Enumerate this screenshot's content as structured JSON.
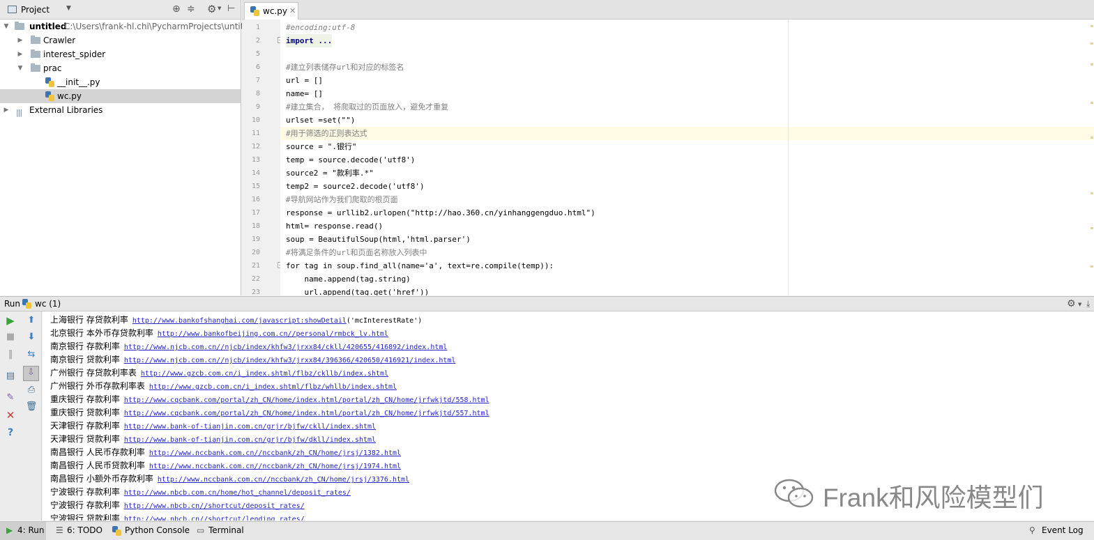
{
  "project_panel": {
    "title": "Project",
    "tree": [
      {
        "label": "untitled",
        "path": "C:\\Users\\frank-hl.chi\\PycharmProjects\\untitled"
      },
      {
        "label": "Crawler"
      },
      {
        "label": "interest_spider"
      },
      {
        "label": "prac"
      },
      {
        "label": "__init__.py"
      },
      {
        "label": "wc.py"
      },
      {
        "label": "External Libraries"
      }
    ]
  },
  "editor": {
    "tab": "wc.py",
    "lines": [
      {
        "n": "1",
        "t": "#encoding:utf-8"
      },
      {
        "n": "2",
        "t": "import ..."
      },
      {
        "n": "5",
        "t": ""
      },
      {
        "n": "6",
        "t": "#建立列表储存url和对应的标签名"
      },
      {
        "n": "7",
        "t": "url = []"
      },
      {
        "n": "8",
        "t": "name= []"
      },
      {
        "n": "9",
        "t": "#建立集合， 将爬取过的页面放入，避免才重复"
      },
      {
        "n": "10",
        "t": "urlset =set(\"\")"
      },
      {
        "n": "11",
        "t": "#用于筛选的正则表达式"
      },
      {
        "n": "12",
        "t": "source = \".银行\""
      },
      {
        "n": "13",
        "t": "temp = source.decode('utf8')"
      },
      {
        "n": "14",
        "t": "source2 = \"款利率.*\""
      },
      {
        "n": "15",
        "t": "temp2 = source2.decode('utf8')"
      },
      {
        "n": "16",
        "t": "#导航网站作为我们爬取的根页面"
      },
      {
        "n": "17",
        "t": "response = urllib2.urlopen(\"http://hao.360.cn/yinhanggengduo.html\")"
      },
      {
        "n": "18",
        "t": "html= response.read()"
      },
      {
        "n": "19",
        "t": "soup = BeautifulSoup(html,'html.parser')"
      },
      {
        "n": "20",
        "t": "#将满足条件的url和页面名称放入列表中"
      },
      {
        "n": "21",
        "t": "for tag in soup.find_all(name='a', text=re.compile(temp)):"
      },
      {
        "n": "22",
        "t": "    name.append(tag.string)"
      },
      {
        "n": "23",
        "t": "    url.append(tag.get('href'))"
      }
    ]
  },
  "run_panel": {
    "label": "Run",
    "config": "wc (1)",
    "output": [
      {
        "text": "上海银行 存贷款利率",
        "url": "http://www.bankofshanghai.com/javascript:showDetail",
        "tail": "('mcInterestRate')"
      },
      {
        "text": "北京银行 本外币存贷款利率",
        "url": "http://www.bankofbeijing.com.cn//personal/rmbck_lv.html",
        "tail": ""
      },
      {
        "text": "南京银行 存款利率",
        "url": "http://www.njcb.com.cn//njcb/index/khfw3/jrxx84/ckll/420655/416892/index.html",
        "tail": ""
      },
      {
        "text": "南京银行 贷款利率",
        "url": "http://www.njcb.com.cn//njcb/index/khfw3/jrxx84/396366/420650/416921/index.html",
        "tail": ""
      },
      {
        "text": "广州银行 存贷款利率表",
        "url": "http://www.gzcb.com.cn/i_index.shtml/flbz/ckllb/index.shtml",
        "tail": ""
      },
      {
        "text": "广州银行 外币存款利率表",
        "url": "http://www.gzcb.com.cn/i_index.shtml/flbz/whllb/index.shtml",
        "tail": ""
      },
      {
        "text": "重庆银行 存款利率",
        "url": "http://www.cqcbank.com/portal/zh_CN/home/index.html/portal/zh_CN/home/jrfwkjtd/558.html",
        "tail": ""
      },
      {
        "text": "重庆银行 贷款利率",
        "url": "http://www.cqcbank.com/portal/zh_CN/home/index.html/portal/zh_CN/home/jrfwkjtd/557.html",
        "tail": ""
      },
      {
        "text": "天津银行 存款利率",
        "url": "http://www.bank-of-tianjin.com.cn/grjr/bjfw/ckll/index.shtml",
        "tail": ""
      },
      {
        "text": "天津银行 贷款利率",
        "url": "http://www.bank-of-tianjin.com.cn/grjr/bjfw/dkll/index.shtml",
        "tail": ""
      },
      {
        "text": "南昌银行 人民币存款利率",
        "url": "http://www.nccbank.com.cn//nccbank/zh_CN/home/jrsj/1382.html",
        "tail": ""
      },
      {
        "text": "南昌银行 人民币贷款利率",
        "url": "http://www.nccbank.com.cn//nccbank/zh_CN/home/jrsj/1974.html",
        "tail": ""
      },
      {
        "text": "南昌银行 小额外币存款利率",
        "url": "http://www.nccbank.com.cn//nccbank/zh_CN/home/jrsj/3376.html",
        "tail": ""
      },
      {
        "text": "宁波银行 存款利率",
        "url": "http://www.nbcb.com.cn/home/hot_channel/deposit_rates/",
        "tail": ""
      },
      {
        "text": "宁波银行 存款利率",
        "url": "http://www.nbcb.cn//shortcut/deposit_rates/",
        "tail": ""
      },
      {
        "text": "宁波银行 贷款利率",
        "url": "http://www.nbcb.cn//shortcut/lending_rates/",
        "tail": ""
      }
    ]
  },
  "bottom_bar": {
    "run": "4: Run",
    "todo": "6: TODO",
    "python_console": "Python Console",
    "terminal": "Terminal",
    "event_log": "Event Log"
  },
  "watermark": "Frank和风险模型们",
  "colors": {
    "link": "#2424c8",
    "comment": "#808080",
    "keyword": "#000080",
    "string": "#008000",
    "highlight": "#fffae3",
    "selection": "#d4d4d4"
  }
}
